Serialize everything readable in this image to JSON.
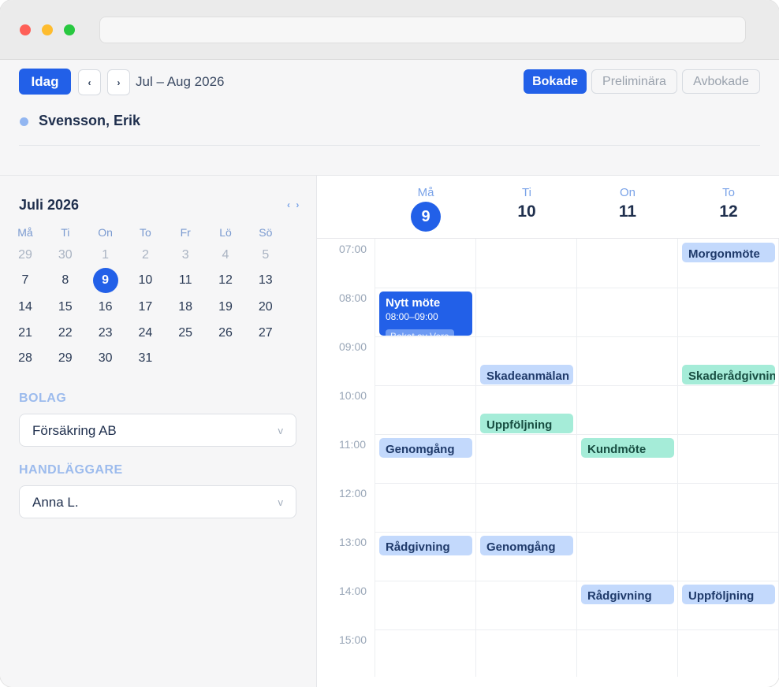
{
  "toolbar": {
    "today_label": "Idag",
    "prev_label": "‹",
    "next_label": "›",
    "range_label": "Jul – Aug 2026",
    "filters": [
      "Bokade",
      "Preliminära",
      "Avbokade"
    ]
  },
  "person": {
    "name": "Svensson, Erik",
    "color": "#92b6f1"
  },
  "mini_calendar": {
    "title": "Juli 2026",
    "nav": "‹ ›",
    "weekdays": [
      "Må",
      "Ti",
      "On",
      "To",
      "Fr",
      "Lö",
      "Sö"
    ],
    "weeks": [
      [
        "29",
        "30",
        "1",
        "2",
        "3",
        "4",
        "5"
      ],
      [
        "7",
        "8",
        "9",
        "10",
        "11",
        "12",
        "13"
      ],
      [
        "14",
        "15",
        "16",
        "17",
        "18",
        "19",
        "20"
      ],
      [
        "21",
        "22",
        "23",
        "24",
        "25",
        "26",
        "27"
      ],
      [
        "28",
        "29",
        "30",
        "31",
        "",
        "",
        ""
      ]
    ],
    "selected": "9"
  },
  "fields": {
    "company_label": "BOLAG",
    "company_value": "Försäkring AB",
    "handler_label": "HANDLÄGGARE",
    "handler_value": "Anna L.",
    "chevron": "v"
  },
  "week": {
    "days": [
      {
        "name": "Må",
        "num": "9",
        "today": true
      },
      {
        "name": "Ti",
        "num": "10",
        "today": false
      },
      {
        "name": "On",
        "num": "11",
        "today": false
      },
      {
        "name": "To",
        "num": "12",
        "today": false
      }
    ],
    "hours": [
      "07:00",
      "08:00",
      "09:00",
      "10:00",
      "11:00",
      "12:00",
      "13:00",
      "14:00",
      "15:00"
    ]
  },
  "events": [
    {
      "day": 0,
      "title": "Nytt möte",
      "time": "08:00–09:00",
      "start": 8.0,
      "end": 9.0,
      "style": "dark",
      "badge": "Bokat av Vera"
    },
    {
      "day": 0,
      "title": "Genomgång",
      "time": "11:00–11:30",
      "start": 11.0,
      "end": 11.5,
      "style": "blue"
    },
    {
      "day": 0,
      "title": "Rådgivning",
      "time": "13:00–13:30",
      "start": 13.0,
      "end": 13.5,
      "style": "blue"
    },
    {
      "day": 1,
      "title": "Skadeanmälan",
      "time": "09:30–10:00",
      "start": 9.5,
      "end": 10.0,
      "style": "blue"
    },
    {
      "day": 1,
      "title": "Uppföljning",
      "time": "10:30–11:00",
      "start": 10.5,
      "end": 11.0,
      "style": "green"
    },
    {
      "day": 1,
      "title": "Genomgång",
      "time": "13:00–13:30",
      "start": 13.0,
      "end": 13.5,
      "style": "blue"
    },
    {
      "day": 2,
      "title": "Kundmöte",
      "time": "11:00–11:30",
      "start": 11.0,
      "end": 11.5,
      "style": "green"
    },
    {
      "day": 2,
      "title": "Rådgivning",
      "time": "14:00–14:30",
      "start": 14.0,
      "end": 14.5,
      "style": "blue"
    },
    {
      "day": 3,
      "title": "Morgonmöte",
      "time": "07:00–07:30",
      "start": 7.0,
      "end": 7.5,
      "style": "blue"
    },
    {
      "day": 3,
      "title": "Skaderådgivning",
      "time": "09:30–10:00",
      "start": 9.5,
      "end": 10.0,
      "style": "green"
    },
    {
      "day": 3,
      "title": "Uppföljning",
      "time": "14:00–14:30",
      "start": 14.0,
      "end": 14.5,
      "style": "blue"
    }
  ]
}
